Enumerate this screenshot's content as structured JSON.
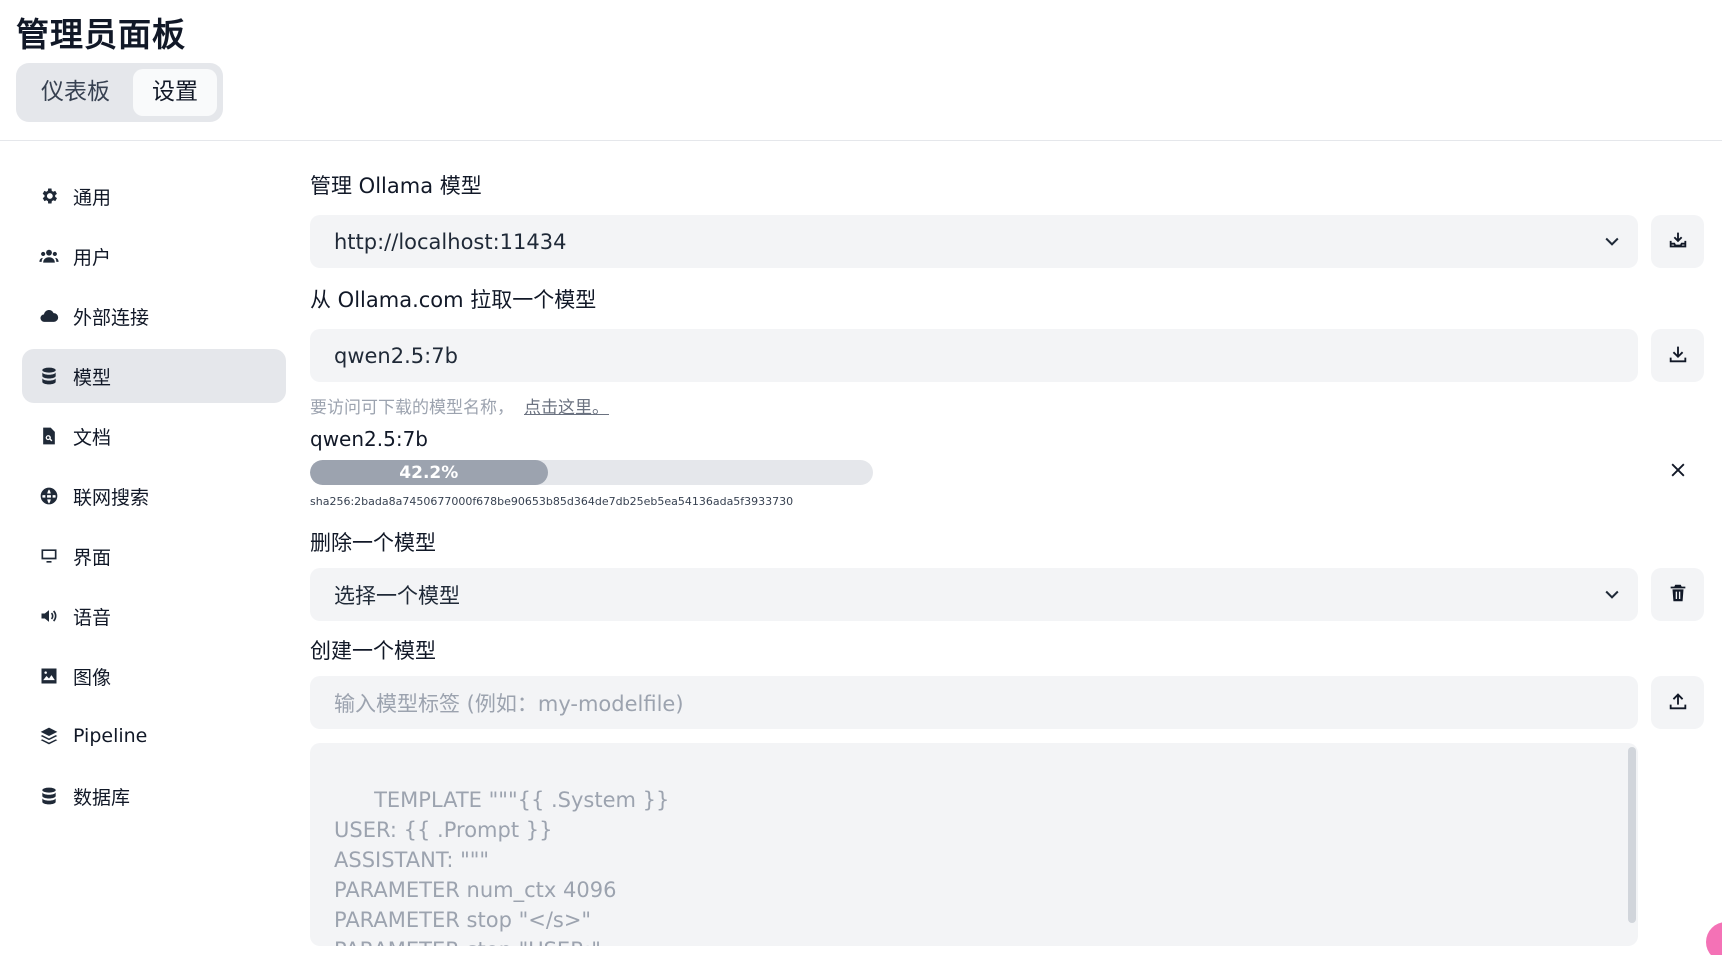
{
  "header": {
    "title": "管理员面板",
    "tabs": [
      {
        "label": "仪表板",
        "active": false
      },
      {
        "label": "设置",
        "active": true
      }
    ]
  },
  "sidebar": {
    "items": [
      {
        "label": "通用",
        "icon": "gear-icon",
        "active": false
      },
      {
        "label": "用户",
        "icon": "users-icon",
        "active": false
      },
      {
        "label": "外部连接",
        "icon": "cloud-icon",
        "active": false
      },
      {
        "label": "模型",
        "icon": "database-icon",
        "active": true
      },
      {
        "label": "文档",
        "icon": "document-search-icon",
        "active": false
      },
      {
        "label": "联网搜索",
        "icon": "globe-icon",
        "active": false
      },
      {
        "label": "界面",
        "icon": "monitor-icon",
        "active": false
      },
      {
        "label": "语音",
        "icon": "speaker-icon",
        "active": false
      },
      {
        "label": "图像",
        "icon": "image-icon",
        "active": false
      },
      {
        "label": "Pipeline",
        "icon": "layers-icon",
        "active": false
      },
      {
        "label": "数据库",
        "icon": "database-icon",
        "active": false
      }
    ]
  },
  "main": {
    "manage": {
      "label": "管理 Ollama 模型",
      "url_value": "http://localhost:11434"
    },
    "pull": {
      "label": "从 Ollama.com 拉取一个模型",
      "input_value": "qwen2.5:7b",
      "hint_text": "要访问可下载的模型名称，",
      "hint_link": "点击这里。"
    },
    "download": {
      "model_name": "qwen2.5:7b",
      "progress_label": "42.2%",
      "progress_value": 0.422,
      "digest": "sha256:2bada8a7450677000f678be90653b85d364de7db25eb5ea54136ada5f3933730"
    },
    "delete": {
      "label": "删除一个模型",
      "select_value": "选择一个模型"
    },
    "create": {
      "label": "创建一个模型",
      "tag_placeholder": "输入模型标签 (例如：my-modelfile)",
      "modelfile_placeholder": "TEMPLATE \"\"\"{{ .System }}\nUSER: {{ .Prompt }}\nASSISTANT: \"\"\"\nPARAMETER num_ctx 4096\nPARAMETER stop \"</s>\"\nPARAMETER stop \"USER:\"\nPARAMETER stop \"ASSISTANT:\""
    }
  }
}
